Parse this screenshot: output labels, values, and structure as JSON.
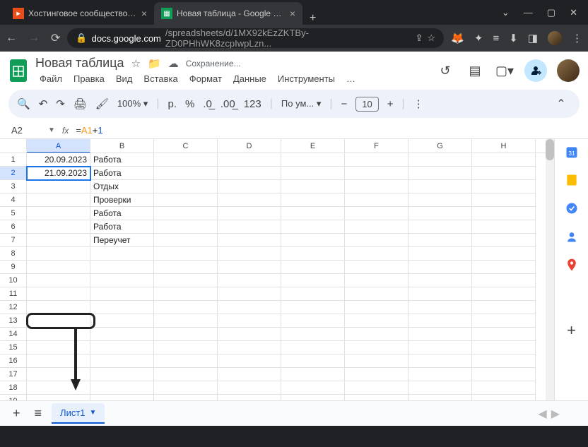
{
  "browser": {
    "tabs": [
      {
        "title": "Хостинговое сообщество «Time...",
        "active": false
      },
      {
        "title": "Новая таблица - Google Таблиц...",
        "active": true
      }
    ],
    "url_host": "docs.google.com",
    "url_path": "/spreadsheets/d/1MX92kEzZKTBy-ZD0PHhWK8zcpIwpLzn..."
  },
  "doc": {
    "title": "Новая таблица",
    "saving": "Сохранение..."
  },
  "menu": {
    "file": "Файл",
    "edit": "Правка",
    "view": "Вид",
    "insert": "Вставка",
    "format": "Формат",
    "data": "Данные",
    "tools": "Инструменты",
    "more": "…"
  },
  "toolbar": {
    "zoom": "100%",
    "currency": "р.",
    "percent": "%",
    "dec_dec": ".0←",
    "inc_dec": ".00→",
    "numfmt": "123",
    "font": "По ум...",
    "font_size": "10"
  },
  "formula": {
    "name_box": "A2",
    "ref": "A1",
    "op": "+",
    "num": "1",
    "prefix": "="
  },
  "columns": [
    "A",
    "B",
    "C",
    "D",
    "E",
    "F",
    "G",
    "H"
  ],
  "rows_count": 19,
  "selected_row": 2,
  "cells": {
    "A1": "20.09.2023",
    "A2": "21.09.2023",
    "B1": "Работа",
    "B2": "Работа",
    "B3": "Отдых",
    "B4": "Проверки",
    "B5": "Работа",
    "B6": "Работа",
    "B7": "Переучет"
  },
  "sheet_tabs": {
    "sheet1": "Лист1"
  }
}
